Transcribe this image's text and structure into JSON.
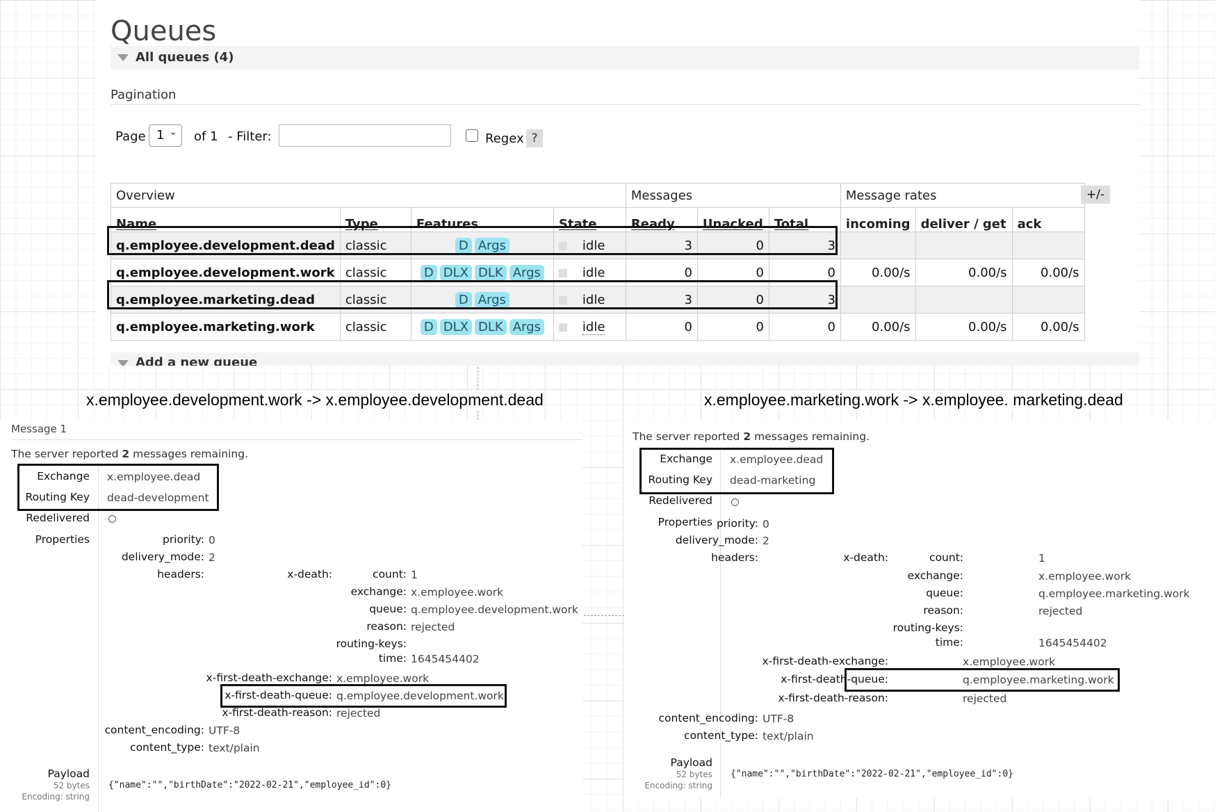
{
  "queues_page": {
    "title": "Queues",
    "all_queues_label": "All queues (4)",
    "pagination_title": "Pagination",
    "page_label": "Page",
    "page_value": "1",
    "of_label": "of 1",
    "filter_label": "- Filter:",
    "filter_value": "",
    "regex_label": "Regex",
    "help_label": "?",
    "plus_minus": "+/-",
    "add_new_queue": "Add a new queue",
    "group_headers": [
      "Overview",
      "Messages",
      "Message rates"
    ],
    "columns": [
      "Name",
      "Type",
      "Features",
      "State",
      "Ready",
      "Unacked",
      "Total",
      "incoming",
      "deliver / get",
      "ack"
    ],
    "rows": [
      {
        "name": "q.employee.development.dead",
        "type": "classic",
        "features": [
          "D",
          "Args"
        ],
        "state": "idle",
        "ready": "3",
        "unacked": "0",
        "total": "3",
        "incoming": "",
        "deliver_get": "",
        "ack": ""
      },
      {
        "name": "q.employee.development.work",
        "type": "classic",
        "features": [
          "D",
          "DLX",
          "DLK",
          "Args"
        ],
        "state": "idle",
        "ready": "0",
        "unacked": "0",
        "total": "0",
        "incoming": "0.00/s",
        "deliver_get": "0.00/s",
        "ack": "0.00/s"
      },
      {
        "name": "q.employee.marketing.dead",
        "type": "classic",
        "features": [
          "D",
          "Args"
        ],
        "state": "idle",
        "ready": "3",
        "unacked": "0",
        "total": "3",
        "incoming": "",
        "deliver_get": "",
        "ack": ""
      },
      {
        "name": "q.employee.marketing.work",
        "type": "classic",
        "features": [
          "D",
          "DLX",
          "DLK",
          "Args"
        ],
        "state": "idle",
        "ready": "0",
        "unacked": "0",
        "total": "0",
        "incoming": "0.00/s",
        "deliver_get": "0.00/s",
        "ack": "0.00/s"
      }
    ]
  },
  "captions": {
    "left": "x.employee.development.work -> x.employee.development.dead",
    "right": "x.employee.marketing.work -> x.employee. marketing.dead"
  },
  "left_message": {
    "title": "Message 1",
    "server_prefix": "The server reported",
    "remaining_count": "2",
    "server_suffix": "messages remaining.",
    "exchange_label": "Exchange",
    "exchange": "x.employee.dead",
    "routing_key_label": "Routing Key",
    "routing_key": "dead-development",
    "redelivered_label": "Redelivered",
    "properties_label": "Properties",
    "priority_label": "priority:",
    "priority": "0",
    "delivery_mode_label": "delivery_mode:",
    "delivery_mode": "2",
    "headers_label": "headers:",
    "x_death_label": "x-death:",
    "count_label": "count:",
    "count": "1",
    "xd_exchange_label": "exchange:",
    "xd_exchange": "x.employee.work",
    "queue_label": "queue:",
    "queue": "q.employee.development.work",
    "reason_label": "reason:",
    "reason": "rejected",
    "routing_keys_label": "routing-keys:",
    "time_label": "time:",
    "time": "1645454402",
    "first_death_exchange_label": "x-first-death-exchange:",
    "first_death_exchange": "x.employee.work",
    "first_death_queue_label": "x-first-death-queue:",
    "first_death_queue": "q.employee.development.work",
    "first_death_reason_label": "x-first-death-reason:",
    "first_death_reason": "rejected",
    "content_encoding_label": "content_encoding:",
    "content_encoding": "UTF-8",
    "content_type_label": "content_type:",
    "content_type": "text/plain",
    "payload_label": "Payload",
    "payload_size": "52 bytes",
    "payload_encoding": "Encoding: string",
    "payload": "{\"name\":\"\",\"birthDate\":\"2022-02-21\",\"employee_id\":0}"
  },
  "right_message": {
    "server_prefix": "The server reported",
    "remaining_count": "2",
    "server_suffix": "messages remaining.",
    "exchange_label": "Exchange",
    "exchange": "x.employee.dead",
    "routing_key_label": "Routing Key",
    "routing_key": "dead-marketing",
    "redelivered_label": "Redelivered",
    "properties_label": "Properties",
    "priority_label": "priority:",
    "priority": "0",
    "delivery_mode_label": "delivery_mode:",
    "delivery_mode": "2",
    "headers_label": "headers:",
    "x_death_label": "x-death:",
    "count_label": "count:",
    "count": "1",
    "xd_exchange_label": "exchange:",
    "xd_exchange": "x.employee.work",
    "queue_label": "queue:",
    "queue": "q.employee.marketing.work",
    "reason_label": "reason:",
    "reason": "rejected",
    "routing_keys_label": "routing-keys:",
    "time_label": "time:",
    "time": "1645454402",
    "first_death_exchange_label": "x-first-death-exchange:",
    "first_death_exchange": "x.employee.work",
    "first_death_queue_label": "x-first-death-queue:",
    "first_death_queue": "q.employee.marketing.work",
    "first_death_reason_label": "x-first-death-reason:",
    "first_death_reason": "rejected",
    "content_encoding_label": "content_encoding:",
    "content_encoding": "UTF-8",
    "content_type_label": "content_type:",
    "content_type": "text/plain",
    "payload_label": "Payload",
    "payload_size": "52 bytes",
    "payload_encoding": "Encoding: string",
    "payload": "{\"name\":\"\",\"birthDate\":\"2022-02-21\",\"employee_id\":0}"
  }
}
